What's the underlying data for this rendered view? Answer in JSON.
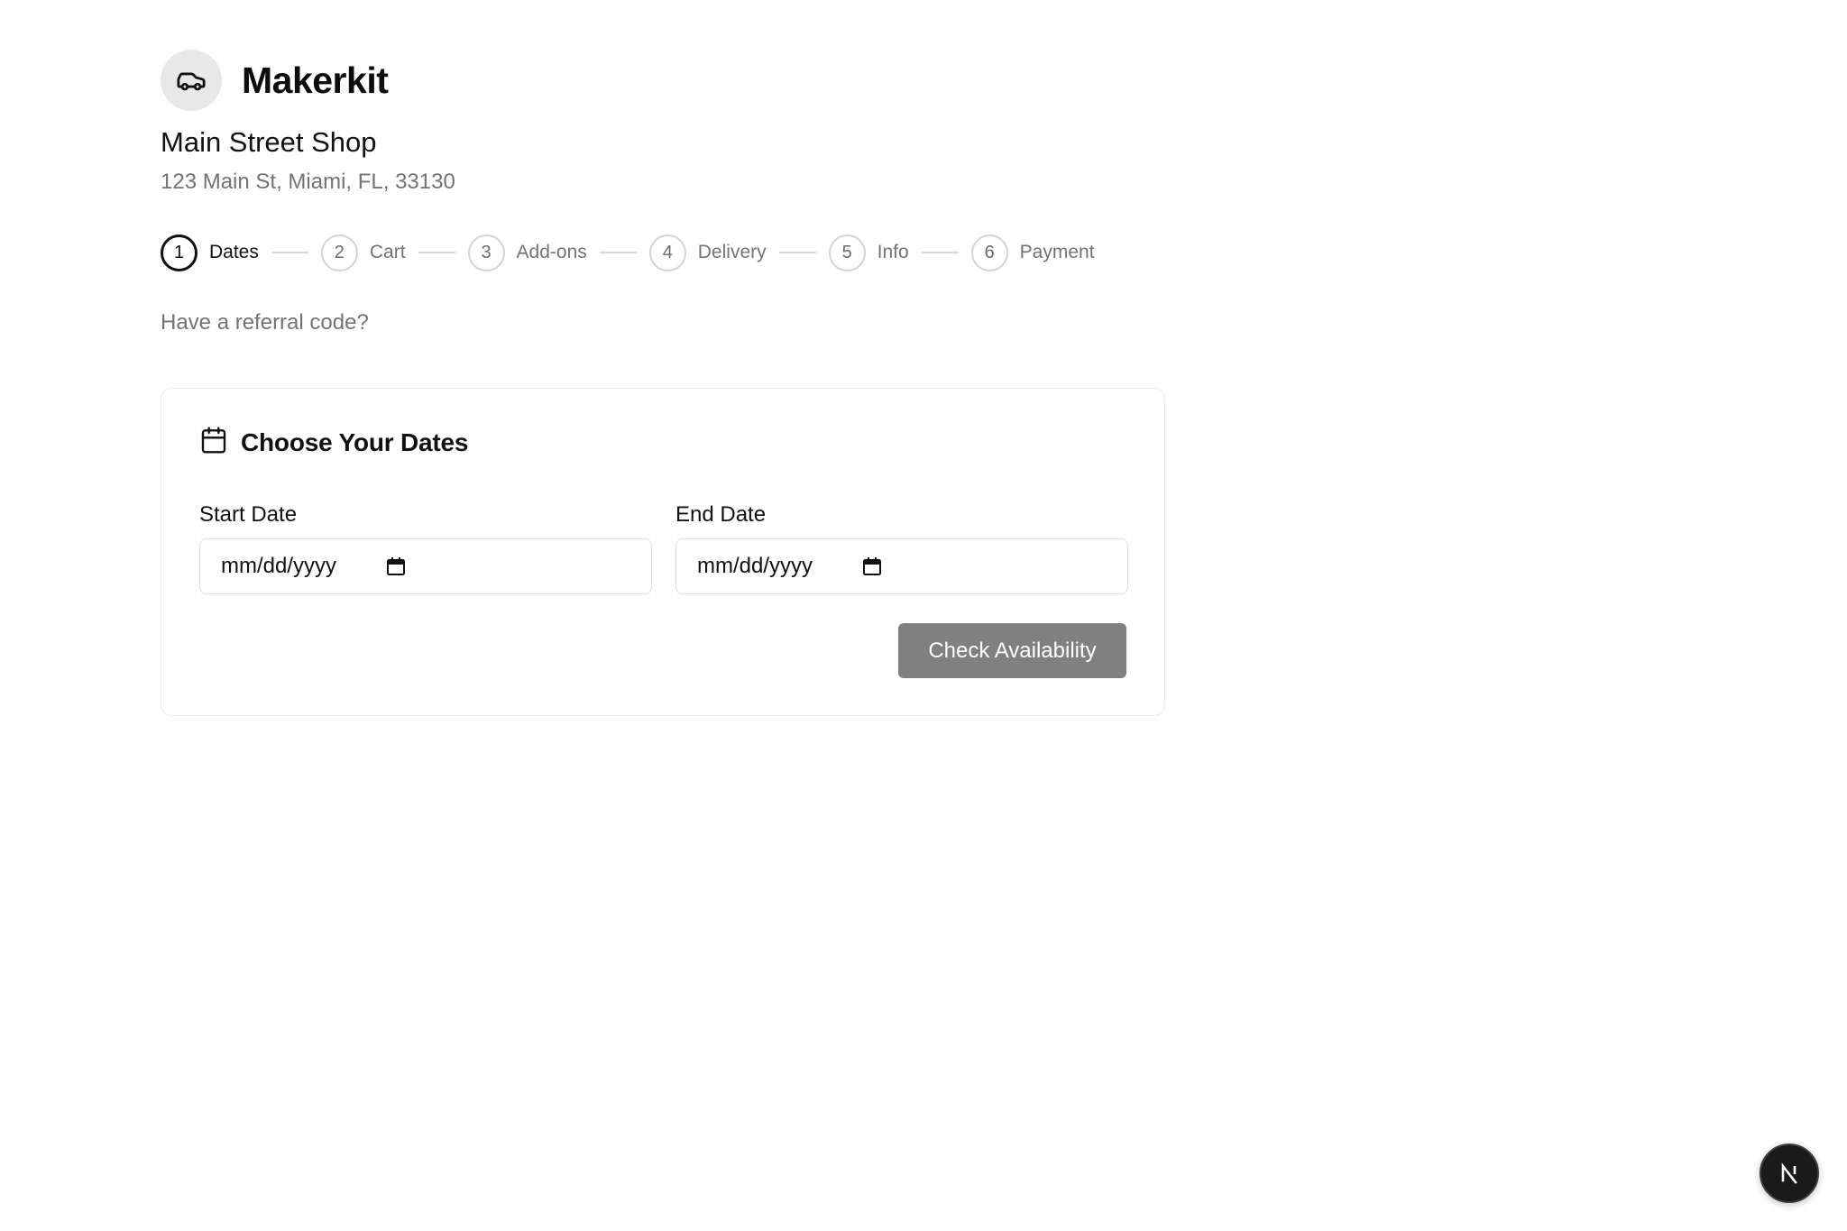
{
  "brand": {
    "name": "Makerkit",
    "logo_icon": "car-icon"
  },
  "shop": {
    "name": "Main Street Shop",
    "address": "123 Main St, Miami, FL, 33130"
  },
  "stepper": {
    "active_step": 1,
    "steps": [
      {
        "number": "1",
        "label": "Dates"
      },
      {
        "number": "2",
        "label": "Cart"
      },
      {
        "number": "3",
        "label": "Add-ons"
      },
      {
        "number": "4",
        "label": "Delivery"
      },
      {
        "number": "5",
        "label": "Info"
      },
      {
        "number": "6",
        "label": "Payment"
      }
    ]
  },
  "referral": {
    "text": "Have a referral code?"
  },
  "dates_card": {
    "title": "Choose Your Dates",
    "title_icon": "calendar-icon",
    "start_date": {
      "label": "Start Date",
      "placeholder": "mm/dd/yyyy",
      "value": ""
    },
    "end_date": {
      "label": "End Date",
      "placeholder": "mm/dd/yyyy",
      "value": ""
    },
    "check_button": "Check Availability"
  },
  "dev_badge": {
    "letter": "N",
    "icon": "nextjs-icon"
  },
  "colors": {
    "text_primary": "#111111",
    "text_muted": "#737373",
    "button_disabled": "#808080",
    "step_border": "#d4d4d4",
    "logo_bg": "#e8e8e8"
  }
}
